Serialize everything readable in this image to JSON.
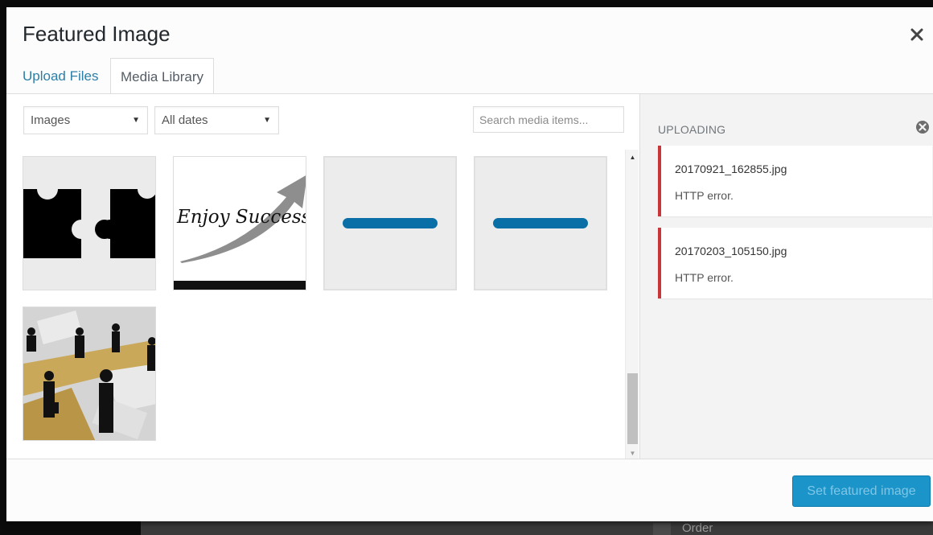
{
  "backdrop": {
    "order_label": "Order"
  },
  "modal": {
    "title": "Featured Image",
    "close_icon": "close-icon"
  },
  "tabs": [
    {
      "label": "Upload Files",
      "active": false
    },
    {
      "label": "Media Library",
      "active": true
    }
  ],
  "filters": {
    "type": {
      "selected": "Images"
    },
    "date": {
      "selected": "All dates"
    },
    "search": {
      "placeholder": "Search media items...",
      "value": ""
    }
  },
  "attachments": [
    {
      "kind": "image",
      "subject": "black puzzle pieces"
    },
    {
      "kind": "image",
      "subject": "Enjoy Success handwriting with arrow",
      "caption_text": "Enjoy Success"
    },
    {
      "kind": "uploading",
      "progress_percent": 100
    },
    {
      "kind": "uploading",
      "progress_percent": 100
    },
    {
      "kind": "image",
      "subject": "business silhouettes over money"
    }
  ],
  "sidebar": {
    "heading": "UPLOADING",
    "errors": [
      {
        "filename": "20170921_162855.jpg",
        "message": "HTTP error."
      },
      {
        "filename": "20170203_105150.jpg",
        "message": "HTTP error."
      }
    ]
  },
  "toolbar": {
    "primary_label": "Set featured image",
    "primary_disabled": true
  },
  "colors": {
    "accent_link": "#2c7fa6",
    "error_border": "#c9363a",
    "primary_button": "#1a94c9",
    "progress_fill": "#0a6fa6"
  }
}
